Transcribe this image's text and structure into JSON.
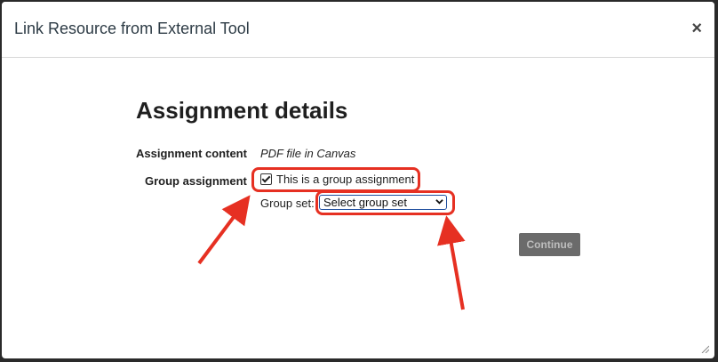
{
  "dialog": {
    "title": "Link Resource from External Tool",
    "close_label": "×"
  },
  "main": {
    "heading": "Assignment details",
    "assignment_content_label": "Assignment content",
    "assignment_content_value": "PDF file in Canvas",
    "group_assignment_label": "Group assignment",
    "group_checkbox_label": "This is a group assignment",
    "group_checkbox_checked": true,
    "group_set_label": "Group set:",
    "group_set_selected": "Select group set",
    "continue_label": "Continue"
  },
  "annotations": {
    "highlight_color": "#e63022"
  },
  "colors": {
    "continue_bg": "#6b6b6b",
    "select_border": "#1f4e9e"
  }
}
